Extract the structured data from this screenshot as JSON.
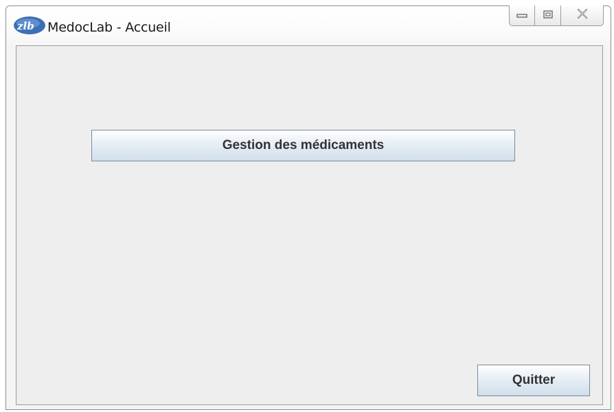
{
  "window": {
    "title": "MedocLab - Accueil",
    "app_icon": "medoclab-logo-icon",
    "caption_buttons": [
      "minimize-icon",
      "maximize-icon",
      "close-icon"
    ]
  },
  "main": {
    "gestion_button_label": "Gestion des médicaments",
    "quit_button_label": "Quitter"
  },
  "colors": {
    "client_background": "#eeeeee",
    "button_text": "#333333",
    "button_border": "#7a8a99",
    "logo_blue": "#3b6fb6"
  }
}
